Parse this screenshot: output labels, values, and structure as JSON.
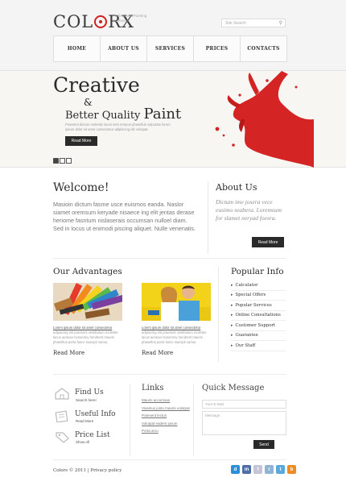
{
  "header": {
    "logo": {
      "part1": "COL",
      "part2": "RX"
    },
    "tagline": "Professional Painting Contractor",
    "search_placeholder": "Site Search"
  },
  "nav": [
    {
      "label": "HOME"
    },
    {
      "label": "ABOUT US"
    },
    {
      "label": "SERVICES"
    },
    {
      "label": "PRICES"
    },
    {
      "label": "CONTACTS"
    }
  ],
  "hero": {
    "title1": "Creative",
    "amp": "&",
    "title2": "Better Quality ",
    "title2_big": "Paint",
    "text": "Praesent dictum molestie lacus sem tempus phasellus vulputate lorem ipsum dolor sit amet consectetur adipiscing elit volutpat.",
    "button": "Read More",
    "paint_color": "#d42424"
  },
  "welcome": {
    "title": "Welcome!",
    "text": "Masioin dictum fasme usce euismos eanda. Naslor siamet oremsum keryade nisaece ing elit jentas derase heriome fasntum nislaserais occumsan nulloel diam. Sed in locus ut enimodi piscing aliquet. Nulle venenatis."
  },
  "about": {
    "title": "About Us",
    "text": "Dictum ime josera vece eusimo seabera. Loremsum for slamet neryad foesra.",
    "button": "Read More"
  },
  "advantages": {
    "title": "Our Advantages",
    "items": [
      {
        "link": "Lorem ipsum dolor sit amet consectetur",
        "text": "adipiscing elit praesent vestibulum molestie lacus aenean nonummy hendrerit mauris phasellus porta fusce suscipit varius.",
        "more": "Read More"
      },
      {
        "link": "Lorem ipsum dolor sit amet consectetur",
        "text": "adipiscing elit praesent vestibulum molestie lacus aenean nonummy hendrerit mauris phasellus porta fusce suscipit varius.",
        "more": "Read More"
      }
    ]
  },
  "popular": {
    "title": "Popular Info",
    "items": [
      {
        "label": "Calculator"
      },
      {
        "label": "Special Offers"
      },
      {
        "label": "Popular Services"
      },
      {
        "label": "Online Consultations"
      },
      {
        "label": "Customer Support"
      },
      {
        "label": "Guarantee"
      },
      {
        "label": "Our Staff"
      }
    ]
  },
  "footer_info": [
    {
      "title": "Find Us",
      "sub": "Search here!"
    },
    {
      "title": "Useful Info",
      "sub": "Read More"
    },
    {
      "title": "Price List",
      "sub": "Show All"
    }
  ],
  "links": {
    "title": "Links",
    "items": [
      {
        "label": "Mauris accumsan"
      },
      {
        "label": "Vivamus justo mauris volutpat"
      },
      {
        "label": "Praesent lectus"
      },
      {
        "label": "Volutpat eadem ipsum"
      },
      {
        "label": "Porta arcu"
      }
    ]
  },
  "quick_message": {
    "title": "Quick Message",
    "email_placeholder": "Your E-Mail",
    "message_placeholder": "Message",
    "send": "Send"
  },
  "footer": {
    "copyright": "Colors © 2011  |  Privacy policy",
    "social": [
      {
        "icon": "delicious-icon",
        "glyph": "d",
        "color": "#2a8fd6"
      },
      {
        "icon": "myspace-icon",
        "glyph": "m",
        "color": "#4f6fa8"
      },
      {
        "icon": "flickr-icon",
        "glyph": "f",
        "color": "#c4c4d8"
      },
      {
        "icon": "rss-icon",
        "glyph": "r",
        "color": "#8fb4d6"
      },
      {
        "icon": "twitter-icon",
        "glyph": "t",
        "color": "#5aa9de"
      },
      {
        "icon": "blogger-icon",
        "glyph": "b",
        "color": "#f08a24"
      }
    ]
  }
}
